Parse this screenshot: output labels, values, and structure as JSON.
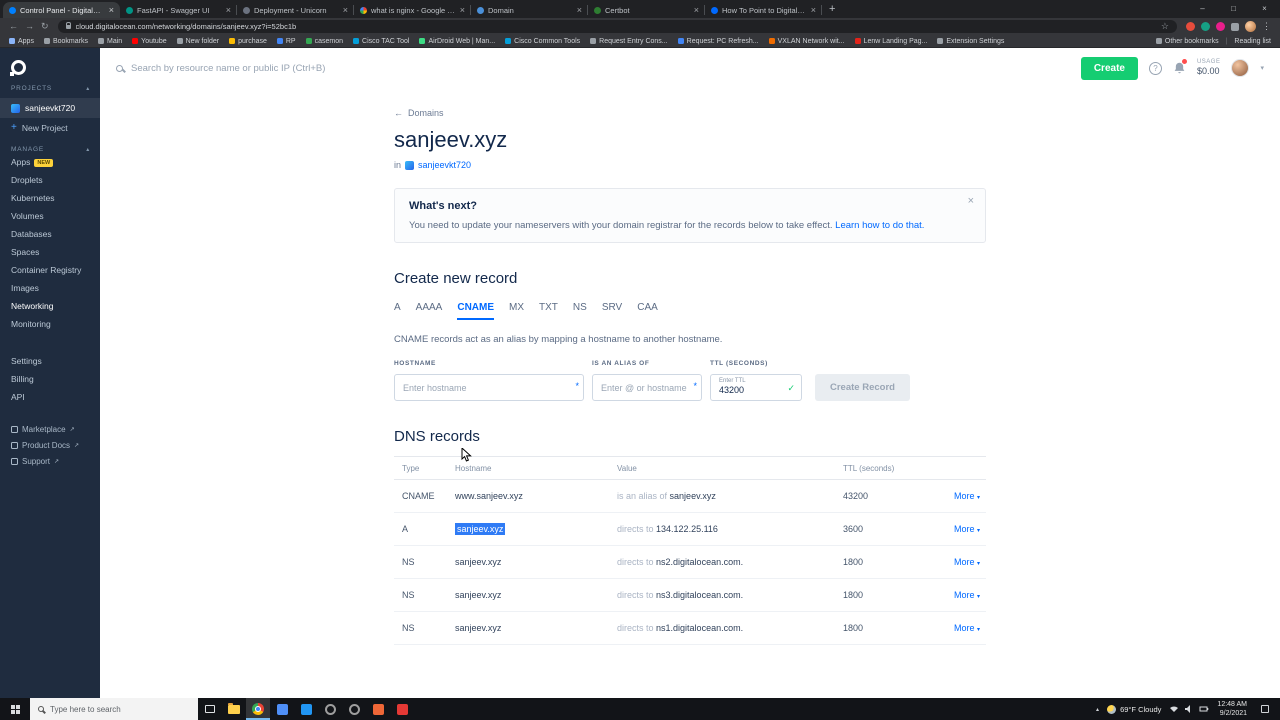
{
  "icons": {
    "close": "×",
    "minimize": "–",
    "maximize": "□",
    "plus": "+",
    "back": "←",
    "forward": "→",
    "refresh": "↻",
    "star": "☆",
    "kebab": "⋮",
    "caret_down": "▾",
    "caret_up": "▴",
    "external": "↗",
    "check": "✓",
    "question": "?",
    "required": "*",
    "divider": "|"
  },
  "browser": {
    "tabs": [
      {
        "title": "Control Panel - DigitalOcea..."
      },
      {
        "title": "FastAPI - Swagger UI"
      },
      {
        "title": "Deployment - Unicorn"
      },
      {
        "title": "what is nginx - Google Search"
      },
      {
        "title": "Domain"
      },
      {
        "title": "Certbot"
      },
      {
        "title": "How To Point to DigitalOcean fo..."
      }
    ],
    "url": "cloud.digitalocean.com/networking/domains/sanjeev.xyz?i=52bc1b",
    "bookmarks": [
      "Apps",
      "Bookmarks",
      "Main",
      "Youtube",
      "New folder",
      "purchase",
      "RP",
      "casemon",
      "Cisco TAC Tool",
      "AirDroid Web | Man...",
      "Cisco Common Tools",
      "Request Entry Cons...",
      "Request: PC Refresh...",
      "VXLAN Network wit...",
      "Lenw Landing Pag...",
      "Extension Settings"
    ],
    "other_bookmarks": "Other bookmarks",
    "reading_list": "Reading list"
  },
  "sidebar": {
    "projects_label": "PROJECTS",
    "project": "sanjeevkt720",
    "new_project": "New Project",
    "manage_label": "MANAGE",
    "items": [
      "Apps",
      "Droplets",
      "Kubernetes",
      "Volumes",
      "Databases",
      "Spaces",
      "Container Registry",
      "Images",
      "Networking",
      "Monitoring"
    ],
    "apps_badge": "NEW",
    "account_items": [
      "Settings",
      "Billing",
      "API"
    ],
    "footer_items": [
      "Marketplace",
      "Product Docs",
      "Support"
    ]
  },
  "topbar": {
    "search_placeholder": "Search by resource name or public IP (Ctrl+B)",
    "create_label": "Create",
    "usage_label": "USAGE",
    "usage_value": "$0.00"
  },
  "main": {
    "breadcrumb": "Domains",
    "title": "sanjeev.xyz",
    "in_label": "in",
    "project_link": "sanjeevkt720",
    "whats_next": {
      "title": "What's next?",
      "body": "You need to update your nameservers with your domain registrar for the records below to take effect.",
      "link": "Learn how to do that."
    },
    "create_record": {
      "heading": "Create new record",
      "tabs": [
        "A",
        "AAAA",
        "CNAME",
        "MX",
        "TXT",
        "NS",
        "SRV",
        "CAA"
      ],
      "description": "CNAME records act as an alias by mapping a hostname to another hostname.",
      "hostname_label": "HOSTNAME",
      "hostname_placeholder": "Enter hostname",
      "alias_label": "IS AN ALIAS OF",
      "alias_placeholder": "Enter @ or hostname",
      "ttl_label": "TTL (SECONDS)",
      "ttl_inner_label": "Enter TTL",
      "ttl_value": "43200",
      "submit_label": "Create Record"
    },
    "dns": {
      "heading": "DNS records",
      "columns": [
        "Type",
        "Hostname",
        "Value",
        "TTL (seconds)"
      ],
      "more_label": "More",
      "rows": [
        {
          "type": "CNAME",
          "hostname": "www.sanjeev.xyz",
          "value_prefix": "is an alias of",
          "value": "sanjeev.xyz",
          "ttl": "43200"
        },
        {
          "type": "A",
          "hostname": "sanjeev.xyz",
          "value_prefix": "directs to",
          "value": "134.122.25.116",
          "ttl": "3600"
        },
        {
          "type": "NS",
          "hostname": "sanjeev.xyz",
          "value_prefix": "directs to",
          "value": "ns2.digitalocean.com.",
          "ttl": "1800"
        },
        {
          "type": "NS",
          "hostname": "sanjeev.xyz",
          "value_prefix": "directs to",
          "value": "ns3.digitalocean.com.",
          "ttl": "1800"
        },
        {
          "type": "NS",
          "hostname": "sanjeev.xyz",
          "value_prefix": "directs to",
          "value": "ns1.digitalocean.com.",
          "ttl": "1800"
        }
      ]
    }
  },
  "taskbar": {
    "search_placeholder": "Type here to search",
    "weather": "69°F Cloudy",
    "time": "12:48 AM",
    "date": "9/2/2021"
  }
}
